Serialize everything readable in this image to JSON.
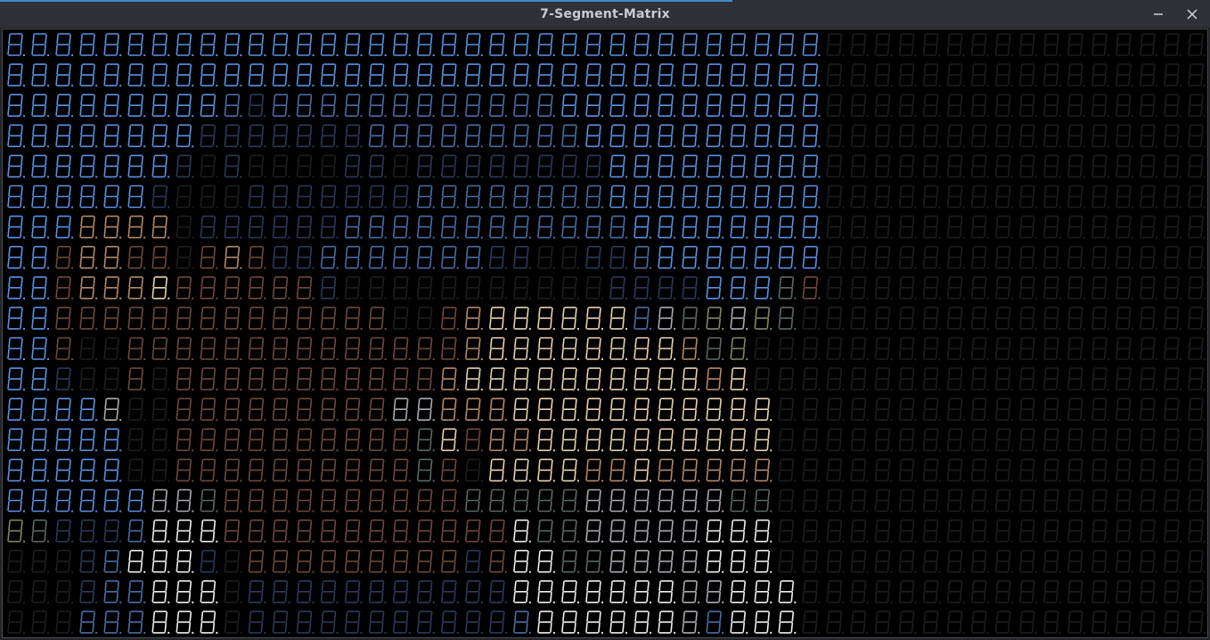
{
  "window": {
    "title": "7-Segment-Matrix",
    "accent_color": "#3b8ec8",
    "controls": [
      {
        "name": "minimize-button",
        "icon": "minimize-icon"
      },
      {
        "name": "close-button",
        "icon": "close-icon"
      }
    ]
  },
  "display": {
    "columns": 50,
    "rows": 20,
    "digit_text": "8.",
    "off_segment_color": "#1c1e20",
    "palette": {
      "B": "#5b93e6",
      "b": "#4a6ea8",
      "n": "#2c3a5a",
      "S": "#e9d3b3",
      "s": "#b48a6a",
      "r": "#6e4a3c",
      "W": "#f0f0f2",
      "w": "#a8acb4",
      "g": "#5a6a66",
      "G": "#7f8a62",
      ".": "#161718"
    },
    "rows_data": [
      "BBBBBBBBBBBBBBBBBBBBBBBBBBBBBBBBBB................",
      "BBBBBBBBBBBBBBBBBBBBBBBBBBBBBBBBBB................",
      "BBBBBBBBBbnbbbbbbbbbbbbBBBBBBBBBBB................",
      "BBBBBBBBnnnnnnnbbbbbbbbbBBBBBBBBBB................",
      "BBBBBBBn.n....nn.nnnnnnnnBBBBBBBBB................",
      "BBBBBBn...nnnnnnnbbbbbbbbBBBBBBBBB................",
      "BBBssss.nnnnnnbbbbbbbbbbbbBBBBBBBB................",
      "BBrssrr.rsrnnbbbbbbbnn..nnbBBBBBBB................",
      "BBrsssSrrrrrrn...........nnnnBBBgr................",
      "BBrrrrrrrrrrrrrr..rsSSSSSSbwgGwGg.................",
      "BBr..rrrrrrrrrrrrrrsSSSSSSSSsgG..................",
      "BBn..r.rrrrrrrrrrrsSSSSSSSSSSsS...................",
      "BBBBw..rrrrrrrrrwwsssSSSSSSSSSSS..................",
      "BBBBB..rrrrrrrrrrgSrssSSSSSSSSSS..................",
      "BBBBB..rrrrrrrrrrgr.SSSSssSsssss..................",
      "BBBBBBwwgrrrrrrrrrrgggggwwwwwwgg..................",
      "GgnnnbWWWrrrrrrrrrrrrWggwwwwwWWW..................",
      "...nbWWWn.rrrrrrrrrnrWWggwwwwWWW..................",
      "...nbbWWW.nnnnnnnnnnnWWWWWWWwwWWW.................",
      "...bbbWWW.nnnnnnnnnnnbWWWWWWwbWWW................."
    ]
  }
}
